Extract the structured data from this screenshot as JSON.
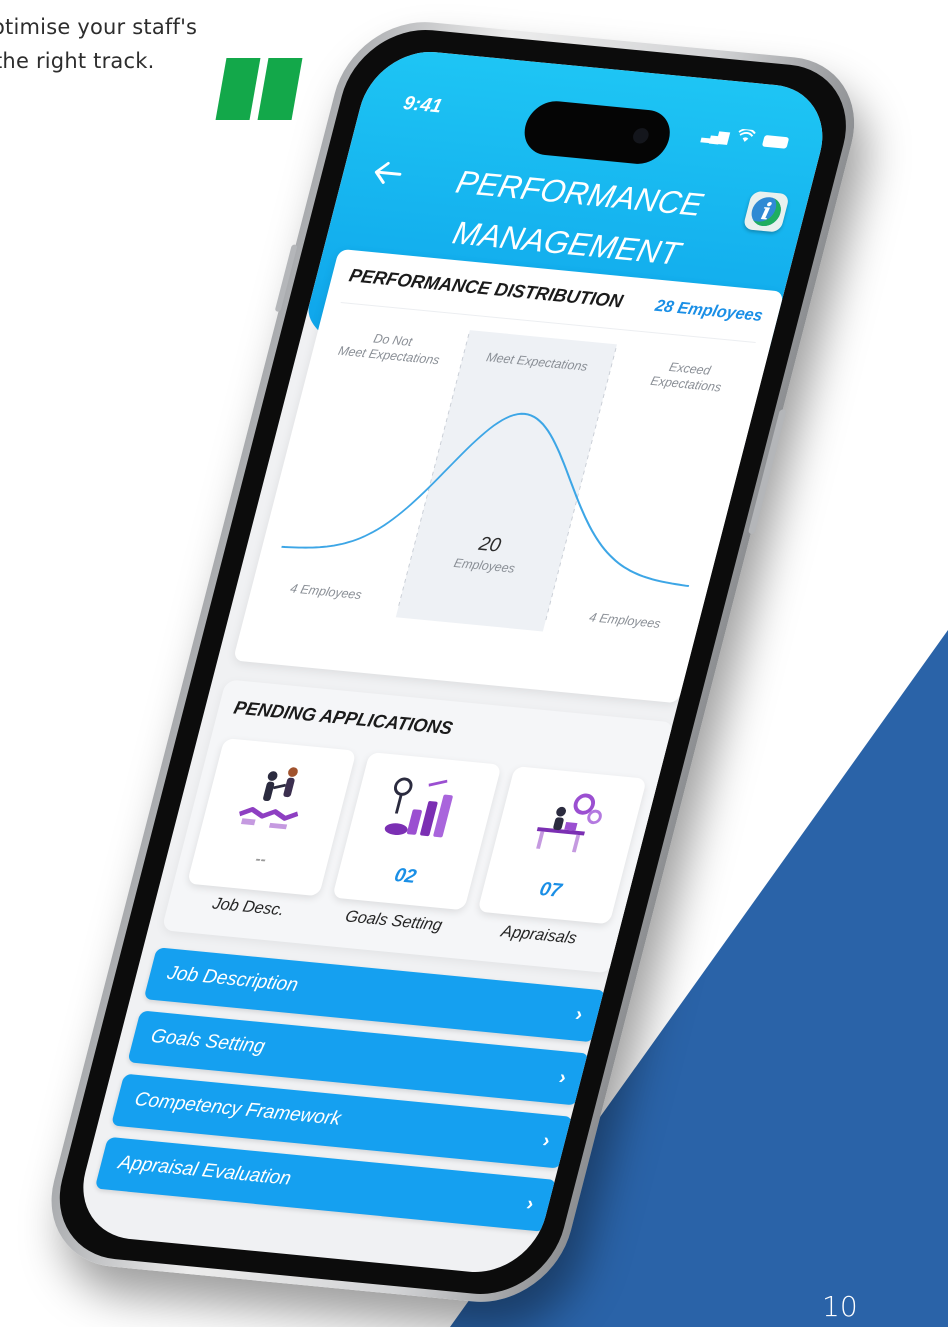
{
  "page": {
    "tagline_lines": [
      "otimise your staff's",
      "the right track."
    ],
    "page_number": "10",
    "colors": {
      "quote_green": "#13a84a",
      "corner_blue": "#2a63a8"
    }
  },
  "status_bar": {
    "time": "9:41",
    "icons": [
      "signal-icon",
      "wifi-icon",
      "battery-icon"
    ]
  },
  "header": {
    "title_line1": "PERFORMANCE",
    "title_line2": "MANAGEMENT",
    "back_icon": "arrow-left-icon",
    "info_icon": "info-icon"
  },
  "performance": {
    "title": "PERFORMANCE DISTRIBUTION",
    "employee_count": "28 Employees",
    "zones": [
      {
        "label_line1": "Do Not",
        "label_line2": "Meet Expectations",
        "count": "4 Employees"
      },
      {
        "label_line1": "Meet Expectations",
        "label_line2": "",
        "count_value": "20",
        "count_unit": "Employees"
      },
      {
        "label_line1": "Exceed",
        "label_line2": "Expectations",
        "count": "4 Employees"
      }
    ]
  },
  "chart_data": {
    "type": "area",
    "categories": [
      "Do Not Meet Expectations",
      "Meet Expectations",
      "Exceed Expectations"
    ],
    "values": [
      4,
      20,
      4
    ],
    "title": "PERFORMANCE DISTRIBUTION",
    "total": 28
  },
  "pending": {
    "title": "PENDING APPLICATIONS",
    "items": [
      {
        "label": "Job Desc.",
        "count": "--",
        "icon": "job-description-illustration"
      },
      {
        "label": "Goals Setting",
        "count": "02",
        "icon": "goals-setting-illustration"
      },
      {
        "label": "Appraisals",
        "count": "07",
        "icon": "appraisals-illustration"
      }
    ]
  },
  "menu": [
    {
      "label": "Job Description",
      "chevron": "›"
    },
    {
      "label": "Goals Setting",
      "chevron": "›"
    },
    {
      "label": "Competency Framework",
      "chevron": "›"
    },
    {
      "label": "Appraisal Evaluation",
      "chevron": "›"
    }
  ]
}
